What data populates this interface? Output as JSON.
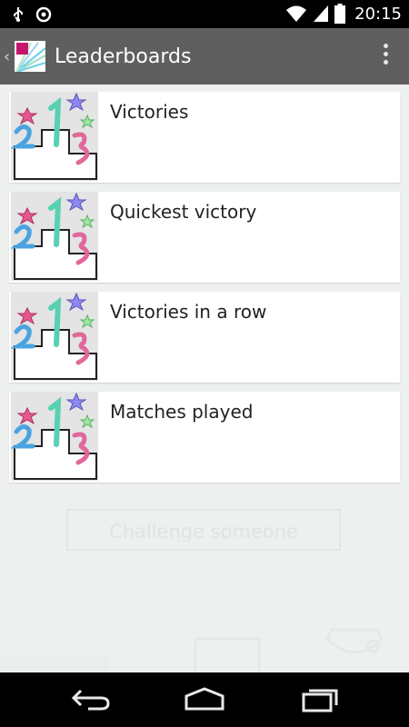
{
  "status_bar": {
    "time": "20:15"
  },
  "action_bar": {
    "title": "Leaderboards"
  },
  "leaderboards": [
    {
      "label": "Victories"
    },
    {
      "label": "Quickest victory"
    },
    {
      "label": "Victories in a row"
    },
    {
      "label": "Matches played"
    }
  ],
  "challenge_button": {
    "label": "Challenge someone"
  },
  "colors": {
    "action_bar": "#5f5f5f",
    "status_bar": "#000000",
    "card": "#ffffff",
    "background": "#edf0ee"
  },
  "icons": [
    "usb-icon",
    "sync-icon",
    "wifi-icon",
    "cell-signal-icon",
    "battery-icon",
    "app-logo-icon",
    "overflow-menu-icon",
    "podium-icon",
    "back-icon",
    "home-icon",
    "recents-icon"
  ]
}
